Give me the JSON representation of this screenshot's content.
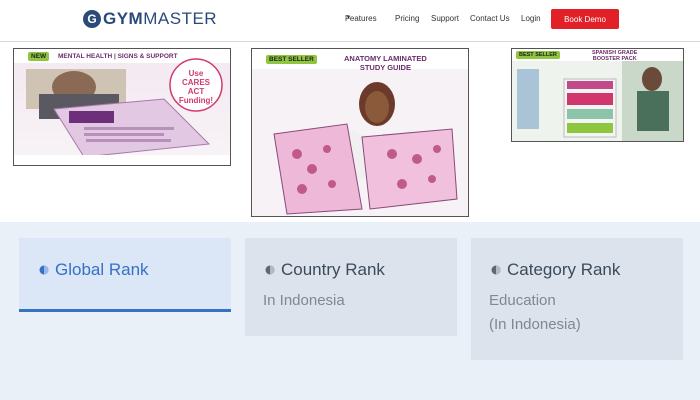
{
  "header": {
    "brand": "GYMMASTER",
    "brand_prefix": "GYM",
    "brand_suffix": "MASTER",
    "logo_letter": "G",
    "nav": [
      {
        "label": "Features",
        "has_caret": true
      },
      {
        "label": "Pricing"
      },
      {
        "label": "Support"
      },
      {
        "label": "Contact Us"
      },
      {
        "label": "Login"
      }
    ],
    "cta_label": "Book Demo",
    "accent": "#e12127",
    "brand_color": "#2a4a7a"
  },
  "products": [
    {
      "badge": "NEW",
      "banner": "MENTAL HEALTH | SIGNS & SUPPORT",
      "callout_lines": [
        "Use",
        "CARES ACT",
        "Funding!"
      ]
    },
    {
      "badge": "BEST SELLER",
      "banner_lines": [
        "ANATOMY LAMINATED",
        "STUDY GUIDE"
      ]
    },
    {
      "badge": "BEST SELLER",
      "banner_lines": [
        "SPANISH GRADE",
        "BOOSTER PACK"
      ]
    }
  ],
  "ranks": [
    {
      "title": "Global Rank",
      "lines": [],
      "active": true
    },
    {
      "title": "Country Rank",
      "lines": [
        "In Indonesia"
      ],
      "active": false
    },
    {
      "title": "Category Rank",
      "lines": [
        "Education",
        "(In Indonesia)"
      ],
      "active": false
    }
  ],
  "colors": {
    "active_blue": "#3671c6",
    "section_bg": "#eaf0f8"
  }
}
